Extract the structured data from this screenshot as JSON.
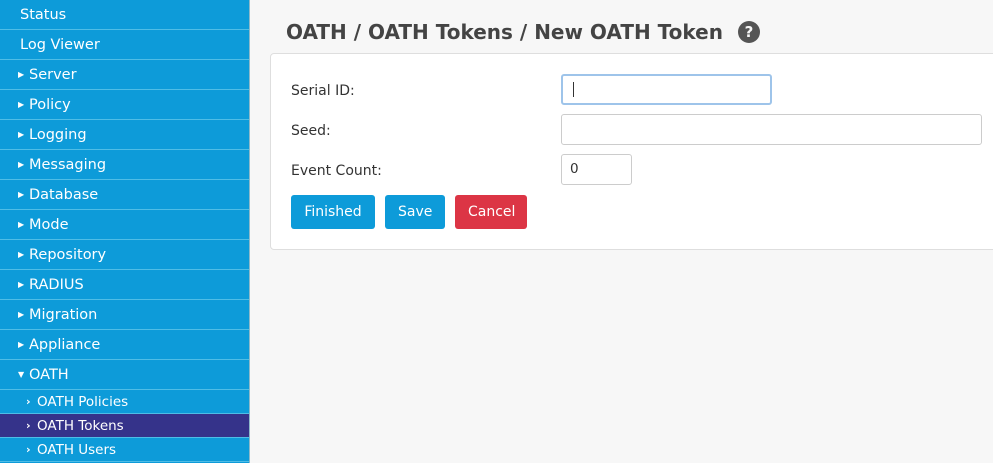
{
  "sidebar": {
    "items": [
      {
        "label": "Status"
      },
      {
        "label": "Log Viewer"
      },
      {
        "label": "Server"
      },
      {
        "label": "Policy"
      },
      {
        "label": "Logging"
      },
      {
        "label": "Messaging"
      },
      {
        "label": "Database"
      },
      {
        "label": "Mode"
      },
      {
        "label": "Repository"
      },
      {
        "label": "RADIUS"
      },
      {
        "label": "Migration"
      },
      {
        "label": "Appliance"
      },
      {
        "label": "OATH"
      }
    ],
    "oath_sub": [
      {
        "label": "OATH Policies"
      },
      {
        "label": "OATH Tokens"
      },
      {
        "label": "OATH Users"
      }
    ],
    "active_sub": "OATH Tokens",
    "colors": {
      "background": "#0d9bd9",
      "active": "#35338a"
    }
  },
  "breadcrumb": {
    "parts": [
      "OATH",
      "OATH Tokens",
      "New OATH Token"
    ],
    "separator": " / "
  },
  "form": {
    "serial_label": "Serial ID:",
    "serial_value": "",
    "seed_label": "Seed:",
    "seed_value": "",
    "event_label": "Event Count:",
    "event_value": "0"
  },
  "buttons": {
    "finished": "Finished",
    "save": "Save",
    "cancel": "Cancel"
  },
  "icons": {
    "help": "?"
  }
}
